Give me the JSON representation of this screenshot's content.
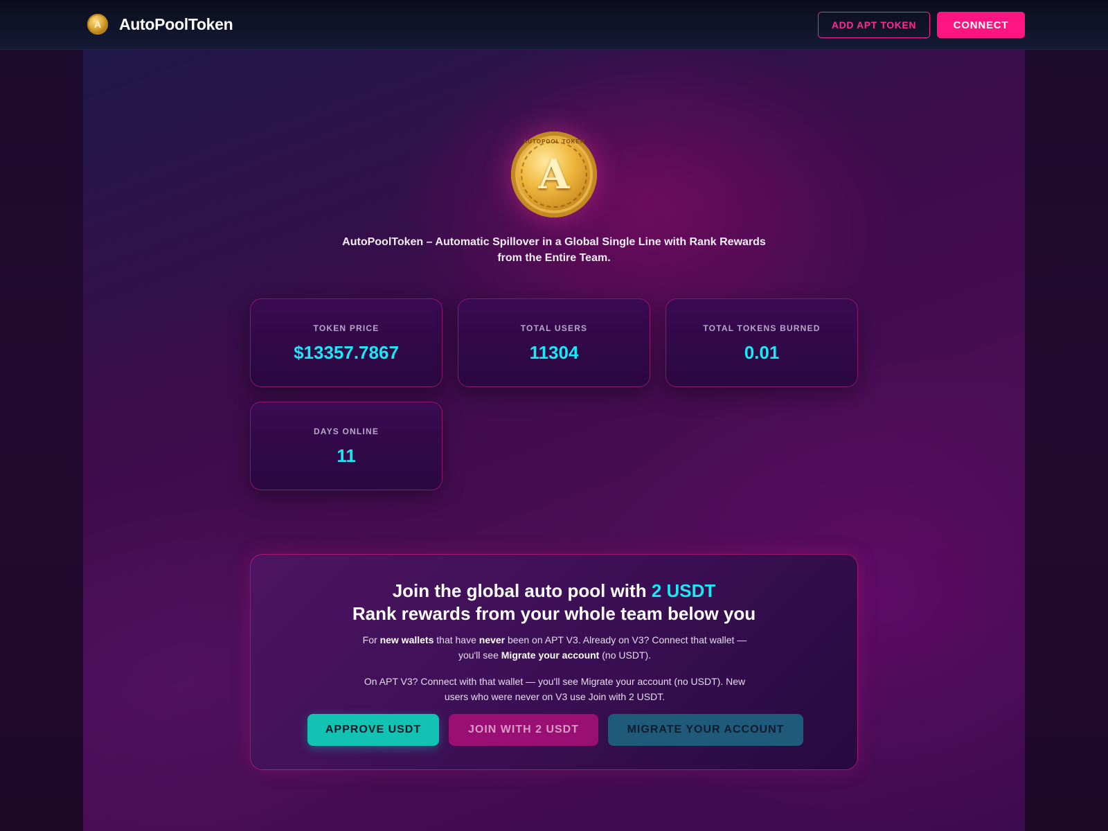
{
  "header": {
    "brand_name": "AutoPoolToken",
    "add_token_label": "ADD APT TOKEN",
    "connect_label": "CONNECT"
  },
  "hero": {
    "coin_text": "AUTOPOOL TOKEN",
    "tagline_line1": "AutoPoolToken – Automatic Spillover in a Global Single Line with Rank Rewards",
    "tagline_line2": "from the Entire Team."
  },
  "stats": [
    {
      "label": "TOKEN PRICE",
      "value": "$13357.7867"
    },
    {
      "label": "TOTAL USERS",
      "value": "11304"
    },
    {
      "label": "TOTAL TOKENS BURNED",
      "value": "0.01"
    },
    {
      "label": "DAYS ONLINE",
      "value": "11"
    }
  ],
  "join": {
    "title_prefix": "Join the global auto pool with ",
    "title_accent": "2 USDT",
    "title_line2": "Rank rewards from your whole team below you",
    "p1_a": "For ",
    "p1_b": "new wallets",
    "p1_c": " that have ",
    "p1_d": "never",
    "p1_e": " been on APT V3. Already on V3? Connect that wallet — you'll see ",
    "p1_f": "Migrate your account",
    "p1_g": " (no USDT).",
    "p2": "On APT V3? Connect with that wallet — you'll see Migrate your account (no USDT). New users who were never on V3 use Join with 2 USDT.",
    "approve_label": "APPROVE USDT",
    "join_label": "JOIN WITH 2 USDT",
    "migrate_label": "MIGRATE YOUR ACCOUNT"
  },
  "colors": {
    "accent_pink": "#ff1582",
    "accent_cyan": "#19e8f5",
    "approve_teal": "#12c3b4"
  }
}
